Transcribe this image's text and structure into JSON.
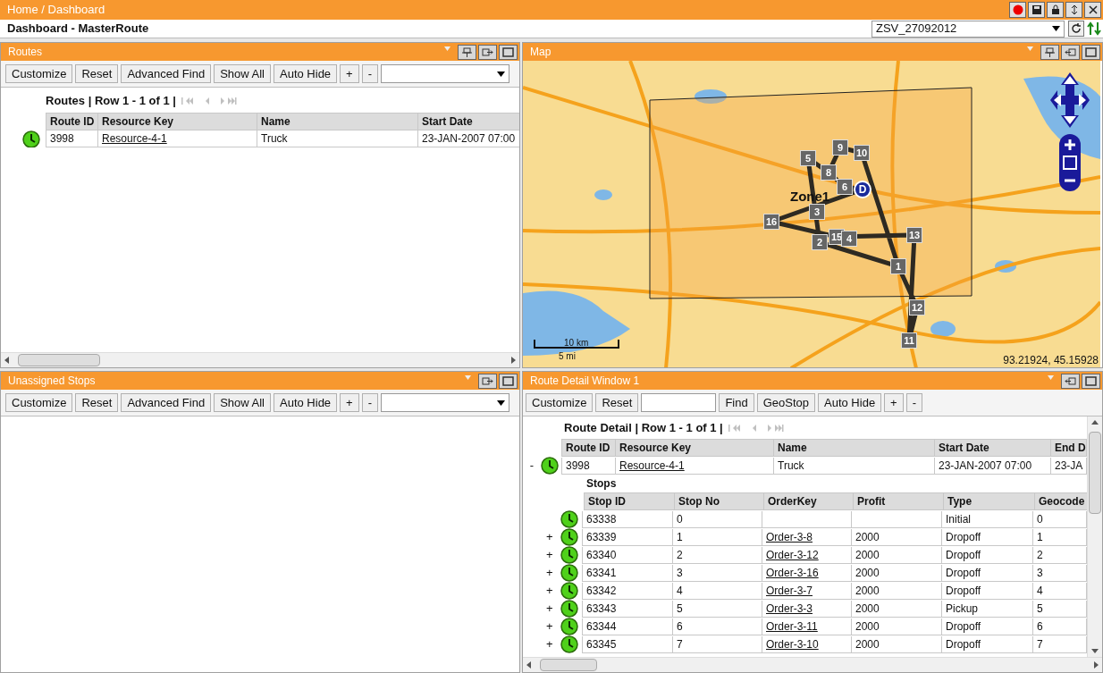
{
  "top_bar": {
    "breadcrumb": "Home / Dashboard"
  },
  "title_bar": {
    "title": "Dashboard - MasterRoute",
    "selector": "ZSV_27092012"
  },
  "routes_panel": {
    "title": "Routes",
    "toolbar": [
      "Customize",
      "Reset",
      "Advanced Find",
      "Show All",
      "Auto Hide",
      "+",
      "-"
    ],
    "pager": "Routes | Row 1 - 1 of 1 |",
    "columns": [
      "Route ID",
      "Resource Key",
      "Name",
      "Start Date"
    ],
    "rows": [
      {
        "cells": [
          {
            "text": "3998",
            "link": false
          },
          {
            "text": "Resource-4-1",
            "link": true
          },
          {
            "text": "Truck",
            "link": false
          },
          {
            "text": "23-JAN-2007 07:00",
            "link": false
          }
        ]
      }
    ]
  },
  "map_panel": {
    "title": "Map",
    "zone_label": "Zone1",
    "depot": "D",
    "stops": [
      {
        "label": "5"
      },
      {
        "label": "9"
      },
      {
        "label": "10"
      },
      {
        "label": "8"
      },
      {
        "label": "6"
      },
      {
        "label": "3"
      },
      {
        "label": "16"
      },
      {
        "label": "2"
      },
      {
        "label": "15"
      },
      {
        "label": "4"
      },
      {
        "label": "13"
      },
      {
        "label": "1"
      },
      {
        "label": "12"
      },
      {
        "label": "11"
      }
    ],
    "scale": {
      "km": "10 km",
      "mi": "5 mi"
    },
    "coordinates": "93.21924, 45.15928"
  },
  "unassigned_panel": {
    "title": "Unassigned Stops",
    "toolbar": [
      "Customize",
      "Reset",
      "Advanced Find",
      "Show All",
      "Auto Hide",
      "+",
      "-"
    ]
  },
  "detail_panel": {
    "title": "Route Detail Window 1",
    "toolbar": [
      {
        "kind": "button",
        "label": "Customize"
      },
      {
        "kind": "button",
        "label": "Reset"
      },
      {
        "kind": "input"
      },
      {
        "kind": "button",
        "label": "Find"
      },
      {
        "kind": "button",
        "label": "GeoStop"
      },
      {
        "kind": "button",
        "label": "Auto Hide"
      },
      {
        "kind": "button",
        "label": "+"
      },
      {
        "kind": "button",
        "label": "-"
      }
    ],
    "pager": "Route Detail | Row 1 - 1 of 1 |",
    "columns": [
      "Route ID",
      "Resource Key",
      "Name",
      "Start Date",
      "End D"
    ],
    "route": {
      "expander": "-",
      "cells": [
        {
          "text": "3998",
          "link": false
        },
        {
          "text": "Resource-4-1",
          "link": true
        },
        {
          "text": "Truck",
          "link": false
        },
        {
          "text": "23-JAN-2007 07:00",
          "link": false
        },
        {
          "text": "23-JA",
          "link": false
        }
      ]
    },
    "stops_label": "Stops",
    "stop_columns": [
      "Stop ID",
      "Stop No",
      "OrderKey",
      "Profit",
      "Type",
      "Geocode"
    ],
    "stops": [
      {
        "cells": [
          {
            "text": "63338",
            "link": false
          },
          {
            "text": "0",
            "link": false
          },
          null,
          null,
          {
            "text": "Initial",
            "link": false
          },
          {
            "text": "0",
            "link": false
          }
        ]
      },
      {
        "expander": "+",
        "cells": [
          {
            "text": "63339",
            "link": false
          },
          {
            "text": "1",
            "link": false
          },
          {
            "text": "Order-3-8",
            "link": true
          },
          {
            "text": "2000",
            "link": false
          },
          {
            "text": "Dropoff",
            "link": false
          },
          {
            "text": "1",
            "link": false
          }
        ]
      },
      {
        "expander": "+",
        "cells": [
          {
            "text": "63340",
            "link": false
          },
          {
            "text": "2",
            "link": false
          },
          {
            "text": "Order-3-12",
            "link": true
          },
          {
            "text": "2000",
            "link": false
          },
          {
            "text": "Dropoff",
            "link": false
          },
          {
            "text": "2",
            "link": false
          }
        ]
      },
      {
        "expander": "+",
        "cells": [
          {
            "text": "63341",
            "link": false
          },
          {
            "text": "3",
            "link": false
          },
          {
            "text": "Order-3-16",
            "link": true
          },
          {
            "text": "2000",
            "link": false
          },
          {
            "text": "Dropoff",
            "link": false
          },
          {
            "text": "3",
            "link": false
          }
        ]
      },
      {
        "expander": "+",
        "cells": [
          {
            "text": "63342",
            "link": false
          },
          {
            "text": "4",
            "link": false
          },
          {
            "text": "Order-3-7",
            "link": true
          },
          {
            "text": "2000",
            "link": false
          },
          {
            "text": "Dropoff",
            "link": false
          },
          {
            "text": "4",
            "link": false
          }
        ]
      },
      {
        "expander": "+",
        "cells": [
          {
            "text": "63343",
            "link": false
          },
          {
            "text": "5",
            "link": false
          },
          {
            "text": "Order-3-3",
            "link": true
          },
          {
            "text": "2000",
            "link": false
          },
          {
            "text": "Pickup",
            "link": false
          },
          {
            "text": "5",
            "link": false
          }
        ]
      },
      {
        "expander": "+",
        "cells": [
          {
            "text": "63344",
            "link": false
          },
          {
            "text": "6",
            "link": false
          },
          {
            "text": "Order-3-11",
            "link": true
          },
          {
            "text": "2000",
            "link": false
          },
          {
            "text": "Dropoff",
            "link": false
          },
          {
            "text": "6",
            "link": false
          }
        ]
      },
      {
        "expander": "+",
        "cells": [
          {
            "text": "63345",
            "link": false
          },
          {
            "text": "7",
            "link": false
          },
          {
            "text": "Order-3-10",
            "link": true
          },
          {
            "text": "2000",
            "link": false
          },
          {
            "text": "Dropoff",
            "link": false
          },
          {
            "text": "7",
            "link": false
          }
        ]
      }
    ]
  }
}
